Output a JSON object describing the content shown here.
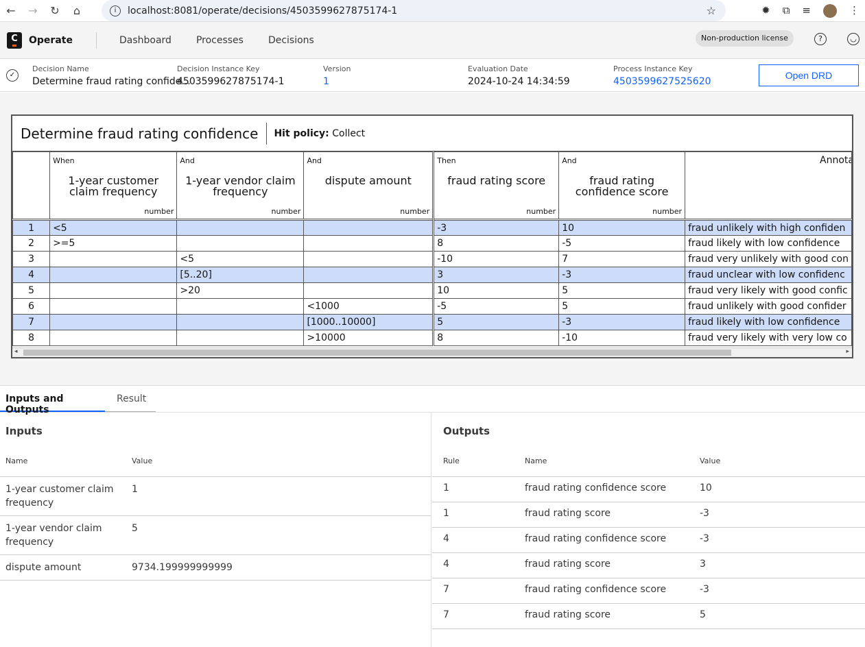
{
  "browser": {
    "url": "localhost:8081/operate/decisions/4503599627875174-1"
  },
  "app": {
    "brand": "Operate",
    "nav": [
      "Dashboard",
      "Processes",
      "Decisions"
    ],
    "license": "Non-production license"
  },
  "info": {
    "decision_name_label": "Decision Name",
    "decision_name": "Determine fraud rating confide...",
    "instance_key_label": "Decision Instance Key",
    "instance_key": "4503599627875174-1",
    "version_label": "Version",
    "version": "1",
    "eval_date_label": "Evaluation Date",
    "eval_date": "2024-10-24 14:34:59",
    "process_key_label": "Process Instance Key",
    "process_key": "4503599627525620",
    "open_drd": "Open DRD"
  },
  "dmn": {
    "title": "Determine fraud rating confidence",
    "hit_policy_label": "Hit policy:",
    "hit_policy": "Collect",
    "columns": [
      {
        "kw": "When",
        "name": "1-year customer claim frequency",
        "type": "number"
      },
      {
        "kw": "And",
        "name": "1-year vendor claim frequency",
        "type": "number"
      },
      {
        "kw": "And",
        "name": "dispute amount",
        "type": "number"
      },
      {
        "kw": "Then",
        "name": "fraud rating score",
        "type": "number"
      },
      {
        "kw": "And",
        "name": "fraud rating confidence score",
        "type": "number"
      },
      {
        "kw": "",
        "name": "Annota",
        "type": ""
      }
    ],
    "rows": [
      {
        "n": "1",
        "c": [
          "<5",
          "",
          "",
          "-3",
          "10",
          "fraud unlikely with high confiden"
        ],
        "hl": true
      },
      {
        "n": "2",
        "c": [
          ">=5",
          "",
          "",
          "8",
          "-5",
          "fraud likely with low confidence"
        ],
        "hl": false
      },
      {
        "n": "3",
        "c": [
          "",
          "<5",
          "",
          "-10",
          "7",
          "fraud very unlikely with good con"
        ],
        "hl": false
      },
      {
        "n": "4",
        "c": [
          "",
          "[5..20]",
          "",
          "3",
          "-3",
          "fraud unclear with low confidenc"
        ],
        "hl": true
      },
      {
        "n": "5",
        "c": [
          "",
          ">20",
          "",
          "10",
          "5",
          "fraud very likely with good confic"
        ],
        "hl": false
      },
      {
        "n": "6",
        "c": [
          "",
          "",
          "<1000",
          "-5",
          "5",
          "fraud unlikely with good confider"
        ],
        "hl": false
      },
      {
        "n": "7",
        "c": [
          "",
          "",
          "[1000..10000]",
          "5",
          "-3",
          "fraud likely with low confidence"
        ],
        "hl": true
      },
      {
        "n": "8",
        "c": [
          "",
          "",
          ">10000",
          "8",
          "-10",
          "fraud very likely with very low co"
        ],
        "hl": false
      }
    ]
  },
  "tabs": [
    "Inputs and Outputs",
    "Result"
  ],
  "inputs": {
    "title": "Inputs",
    "headers": [
      "Name",
      "Value"
    ],
    "rows": [
      {
        "name": "1-year customer claim frequency",
        "value": "1"
      },
      {
        "name": "1-year vendor claim frequency",
        "value": "5"
      },
      {
        "name": "dispute amount",
        "value": "9734.199999999999"
      }
    ]
  },
  "outputs": {
    "title": "Outputs",
    "headers": [
      "Rule",
      "Name",
      "Value"
    ],
    "rows": [
      {
        "rule": "1",
        "name": "fraud rating confidence score",
        "value": "10"
      },
      {
        "rule": "1",
        "name": "fraud rating score",
        "value": "-3"
      },
      {
        "rule": "4",
        "name": "fraud rating confidence score",
        "value": "-3"
      },
      {
        "rule": "4",
        "name": "fraud rating score",
        "value": "3"
      },
      {
        "rule": "7",
        "name": "fraud rating confidence score",
        "value": "-3"
      },
      {
        "rule": "7",
        "name": "fraud rating score",
        "value": "5"
      }
    ]
  }
}
